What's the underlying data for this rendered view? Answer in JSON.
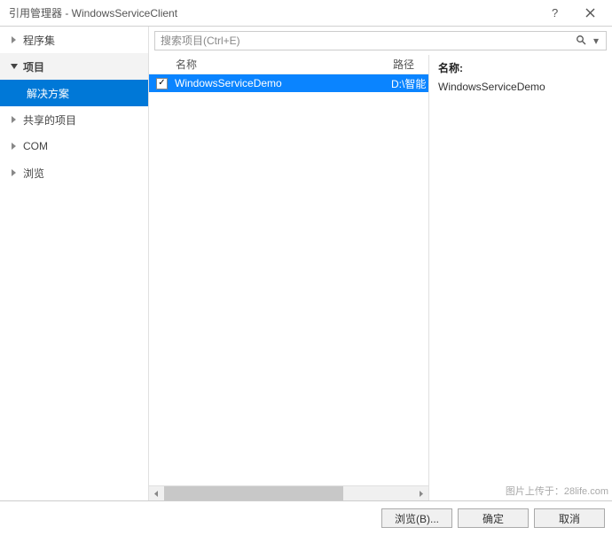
{
  "window": {
    "title": "引用管理器 - WindowsServiceClient"
  },
  "sidebar": {
    "items": [
      {
        "label": "程序集",
        "expanded": false,
        "selected": false
      },
      {
        "label": "项目",
        "expanded": true,
        "selected": true,
        "children": [
          {
            "label": "解决方案",
            "selected": true
          }
        ]
      },
      {
        "label": "共享的项目",
        "expanded": false,
        "selected": false
      },
      {
        "label": "COM",
        "expanded": false,
        "selected": false
      },
      {
        "label": "浏览",
        "expanded": false,
        "selected": false
      }
    ]
  },
  "search": {
    "placeholder": "搜索项目(Ctrl+E)"
  },
  "list": {
    "headers": {
      "name": "名称",
      "path": "路径"
    },
    "rows": [
      {
        "checked": true,
        "name": "WindowsServiceDemo",
        "path": "D:\\智能"
      }
    ]
  },
  "details": {
    "label_name": "名称:",
    "name_value": "WindowsServiceDemo"
  },
  "buttons": {
    "browse": "浏览(B)...",
    "ok": "确定",
    "cancel": "取消"
  },
  "watermark": "图片上传于：28life.com"
}
